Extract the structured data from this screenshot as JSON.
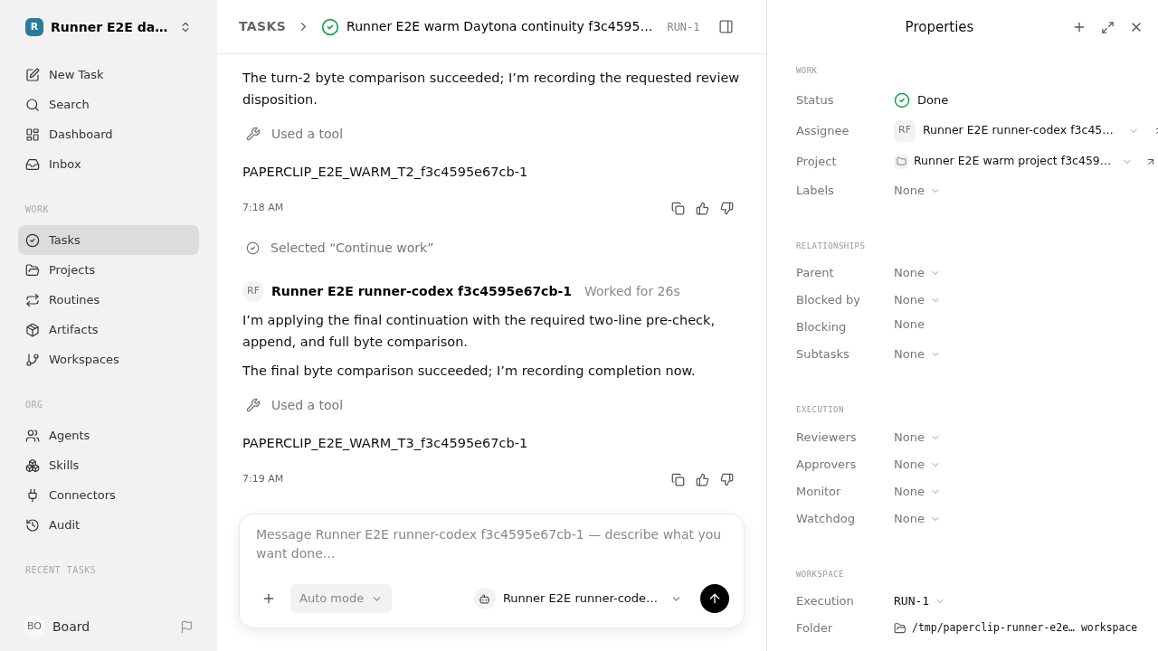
{
  "sidebar": {
    "workspace": {
      "initial": "R",
      "name": "Runner E2E da…"
    },
    "nav": [
      {
        "label": "New Task",
        "selected": false
      },
      {
        "label": "Search",
        "selected": false
      },
      {
        "label": "Dashboard",
        "selected": false
      },
      {
        "label": "Inbox",
        "selected": false
      }
    ],
    "sections": [
      {
        "heading": "WORK",
        "items": [
          {
            "label": "Tasks",
            "selected": true
          },
          {
            "label": "Projects",
            "selected": false
          },
          {
            "label": "Routines",
            "selected": false
          },
          {
            "label": "Artifacts",
            "selected": false
          },
          {
            "label": "Workspaces",
            "selected": false
          }
        ]
      },
      {
        "heading": "ORG",
        "items": [
          {
            "label": "Agents",
            "selected": false
          },
          {
            "label": "Skills",
            "selected": false
          },
          {
            "label": "Connectors",
            "selected": false
          },
          {
            "label": "Audit",
            "selected": false
          }
        ]
      },
      {
        "heading": "RECENT TASKS"
      }
    ],
    "user": {
      "initials": "BO",
      "name": "Board"
    }
  },
  "header": {
    "breadcrumb": "TASKS",
    "title": "Runner E2E warm Daytona continuity f3c4595…",
    "run": "RUN-1"
  },
  "feed": [
    {
      "kind": "text",
      "text": "The turn-2 byte comparison succeeded; I’m recording the requested review disposition."
    },
    {
      "kind": "tool",
      "text": "Used a tool"
    },
    {
      "kind": "output",
      "text": "PAPERCLIP_E2E_WARM_T2_f3c4595e67cb-1"
    },
    {
      "kind": "meta",
      "time": "7:18 AM"
    },
    {
      "kind": "event",
      "text": "Selected “Continue work”"
    },
    {
      "kind": "author",
      "initials": "RF",
      "name": "Runner E2E runner-codex f3c4595e67cb-1",
      "note": "Worked for 26s"
    },
    {
      "kind": "text",
      "text": "I’m applying the final continuation with the required two-line pre-check, append, and full byte comparison."
    },
    {
      "kind": "text",
      "text": "The final byte comparison succeeded; I’m recording completion now."
    },
    {
      "kind": "tool",
      "text": "Used a tool"
    },
    {
      "kind": "output",
      "text": "PAPERCLIP_E2E_WARM_T3_f3c4595e67cb-1"
    },
    {
      "kind": "meta",
      "time": "7:19 AM"
    }
  ],
  "composer": {
    "placeholder": "Message Runner E2E runner-codex f3c4595e67cb-1 — describe what you want done...",
    "mode": "Auto mode",
    "agent": "Runner E2E runner-code…"
  },
  "properties": {
    "title": "Properties",
    "sections": [
      {
        "heading": "WORK",
        "rows": [
          {
            "label": "Status",
            "kind": "status",
            "value": "Done"
          },
          {
            "label": "Assignee",
            "kind": "person",
            "initials": "RF",
            "value": "Runner E2E runner-codex f3c45…"
          },
          {
            "label": "Project",
            "kind": "project",
            "value": "Runner E2E warm project f3c459…"
          },
          {
            "label": "Labels",
            "kind": "select",
            "value": "None"
          }
        ]
      },
      {
        "heading": "RELATIONSHIPS",
        "rows": [
          {
            "label": "Parent",
            "kind": "select",
            "value": "None"
          },
          {
            "label": "Blocked by",
            "kind": "select",
            "value": "None"
          },
          {
            "label": "Blocking",
            "kind": "plain",
            "value": "None"
          },
          {
            "label": "Subtasks",
            "kind": "select",
            "value": "None"
          }
        ]
      },
      {
        "heading": "EXECUTION",
        "rows": [
          {
            "label": "Reviewers",
            "kind": "select",
            "value": "None"
          },
          {
            "label": "Approvers",
            "kind": "select",
            "value": "None"
          },
          {
            "label": "Monitor",
            "kind": "select",
            "value": "None"
          },
          {
            "label": "Watchdog",
            "kind": "select",
            "value": "None"
          }
        ]
      },
      {
        "heading": "WORKSPACE",
        "rows": [
          {
            "label": "Execution",
            "kind": "run",
            "value": "RUN-1"
          },
          {
            "label": "Folder",
            "kind": "path",
            "value": "/tmp/paperclip-runner-e2e… workspace"
          }
        ]
      }
    ]
  }
}
